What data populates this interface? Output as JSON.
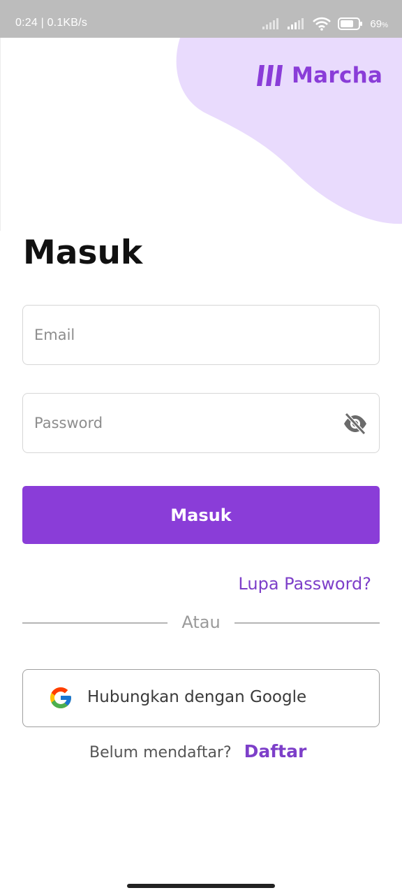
{
  "status_bar": {
    "time_speed": "0:24 | 0.1KB/s",
    "battery": "69",
    "battery_unit": "%"
  },
  "brand": {
    "name": "Marcha",
    "icon": "marcha-logo-icon",
    "color": "#8a3dd8"
  },
  "header": {
    "title": "Masuk",
    "blob_color": "#e9dbfd"
  },
  "form": {
    "email_placeholder": "Email",
    "email_value": "",
    "password_placeholder": "Password",
    "password_value": "",
    "password_toggle_icon": "eye-off-icon",
    "submit_label": "Masuk",
    "forgot_label": "Lupa Password?"
  },
  "divider": {
    "label": "Atau"
  },
  "google": {
    "label": "Hubungkan dengan Google",
    "icon": "google-icon"
  },
  "signup": {
    "prompt": "Belum mendaftar?",
    "link_label": "Daftar"
  },
  "colors": {
    "accent": "#8a3dd8",
    "link": "#7d3fc9",
    "status_bar": "#bcbcbc"
  }
}
